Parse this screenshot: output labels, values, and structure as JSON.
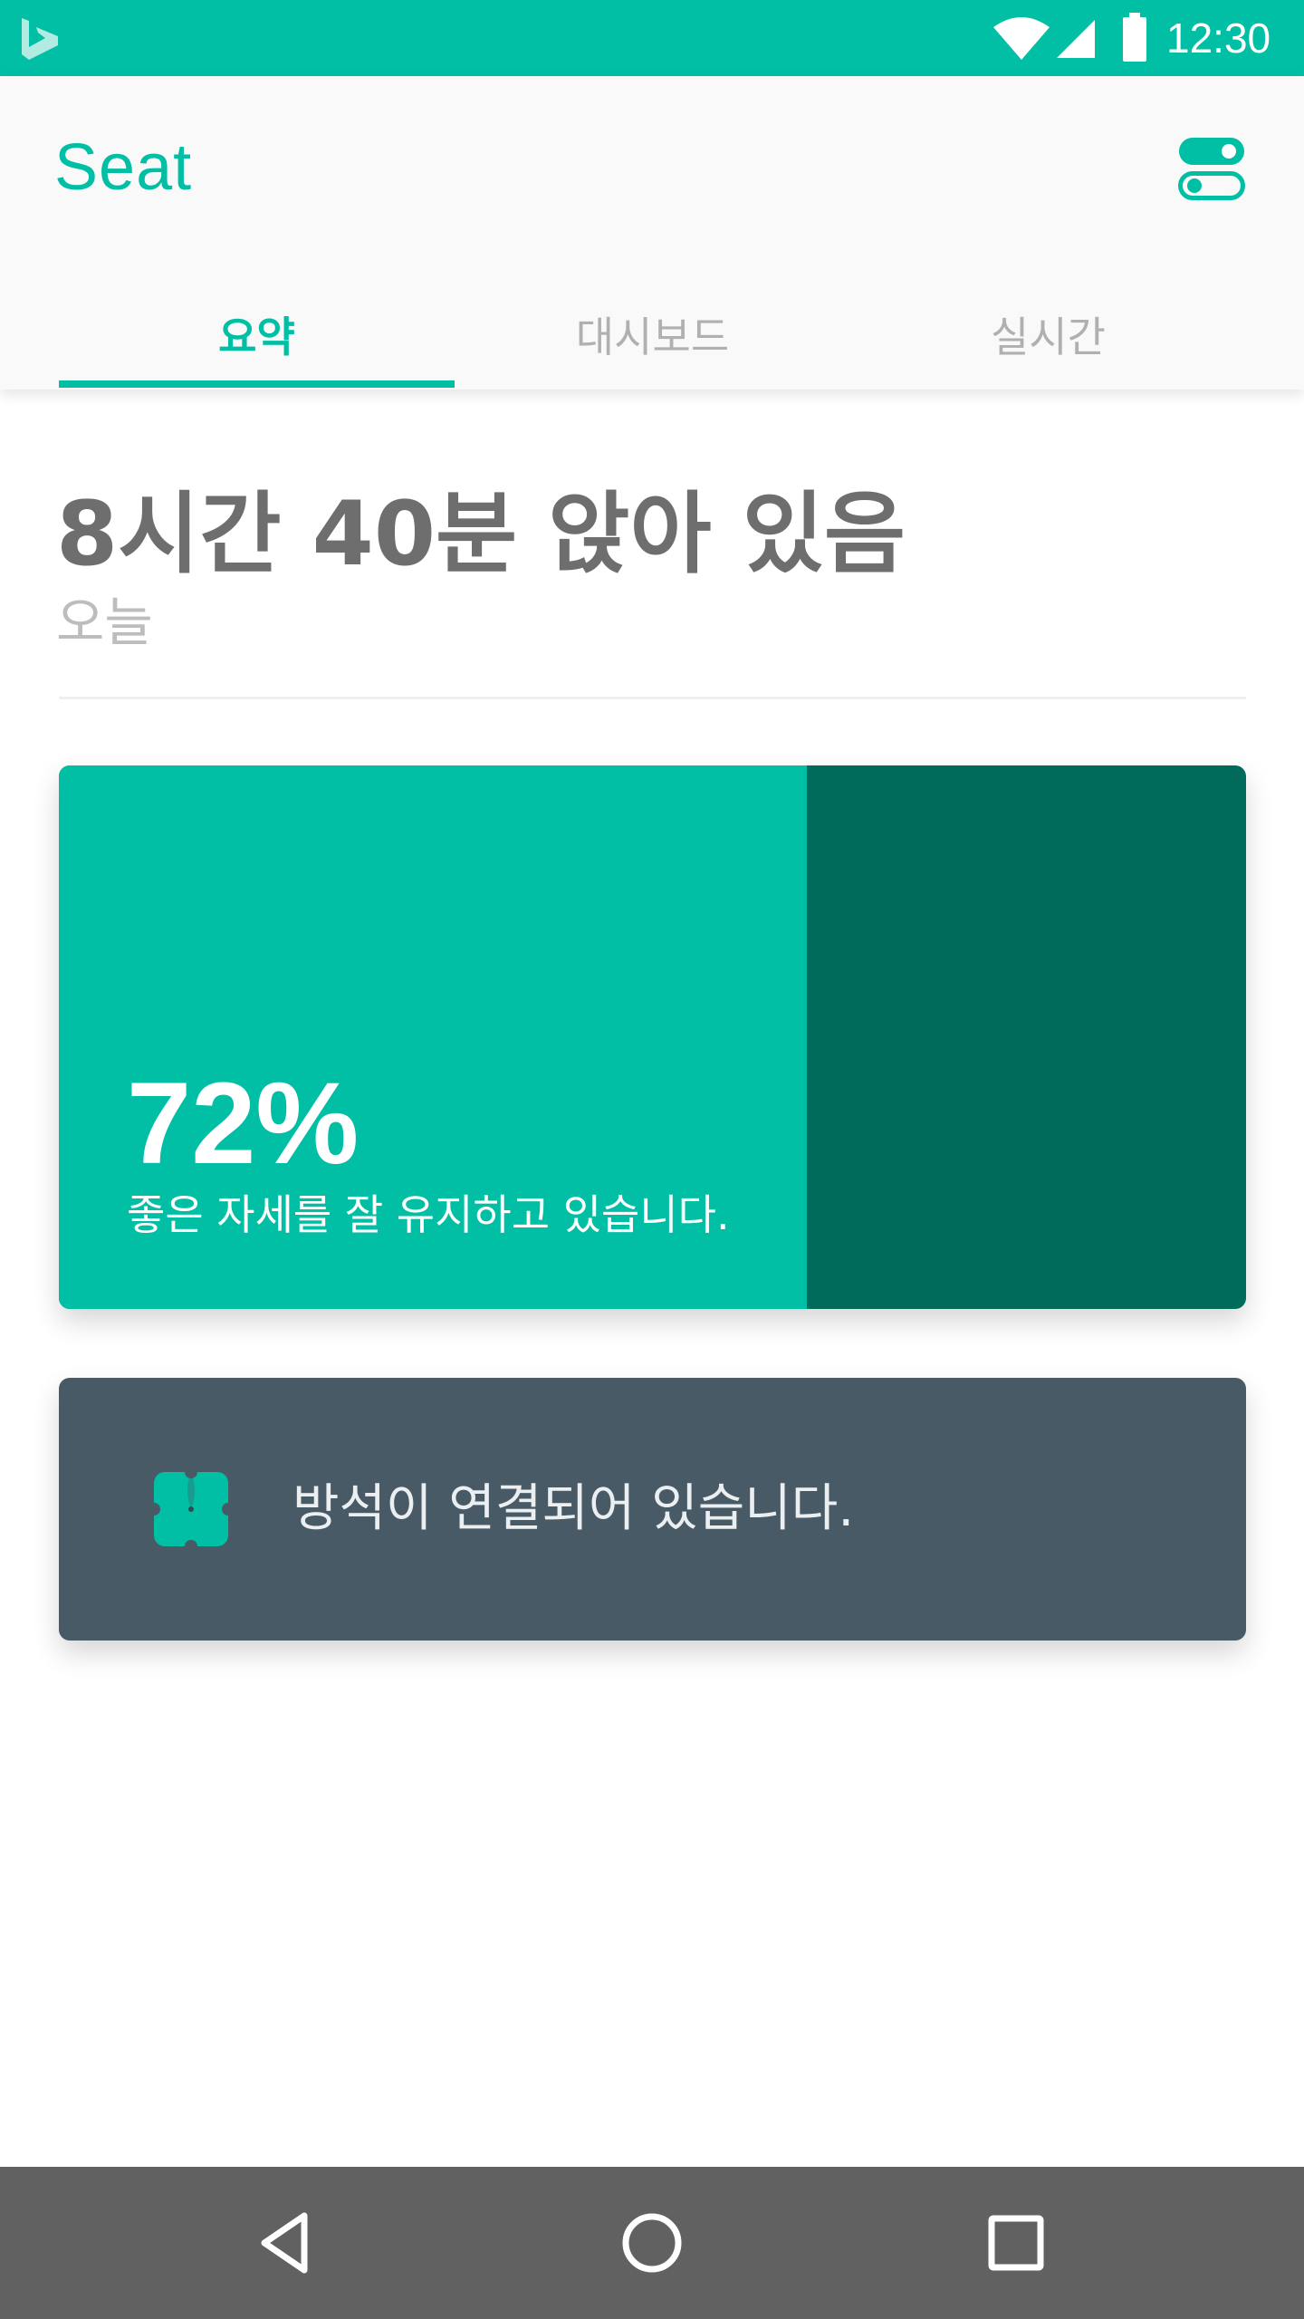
{
  "status_bar": {
    "time": "12:30",
    "icons": [
      "bing-logo-icon",
      "wifi-icon",
      "cell-signal-icon",
      "battery-icon"
    ]
  },
  "app": {
    "title": "Seat",
    "settings_icon": "toggle-switches-icon"
  },
  "tabs": [
    {
      "label": "요약",
      "active": true
    },
    {
      "label": "대시보드",
      "active": false
    },
    {
      "label": "실시간",
      "active": false
    }
  ],
  "summary": {
    "heading": "8시간 40분 앉아 있음",
    "subheading": "오늘"
  },
  "posture": {
    "percent_label": "72%",
    "good_fraction": 0.63,
    "message": "좋은 자세를 잘 유지하고 있습니다."
  },
  "connection": {
    "icon": "seat-cushion-icon",
    "message": "방석이 연결되어 있습니다."
  },
  "nav_bar": {
    "buttons": [
      "back-icon",
      "home-icon",
      "recents-icon"
    ]
  },
  "colors": {
    "accent": "#00BFA5",
    "accent_dark": "#006B5A",
    "card_dark": "#485A66",
    "nav_bar": "#616161"
  }
}
